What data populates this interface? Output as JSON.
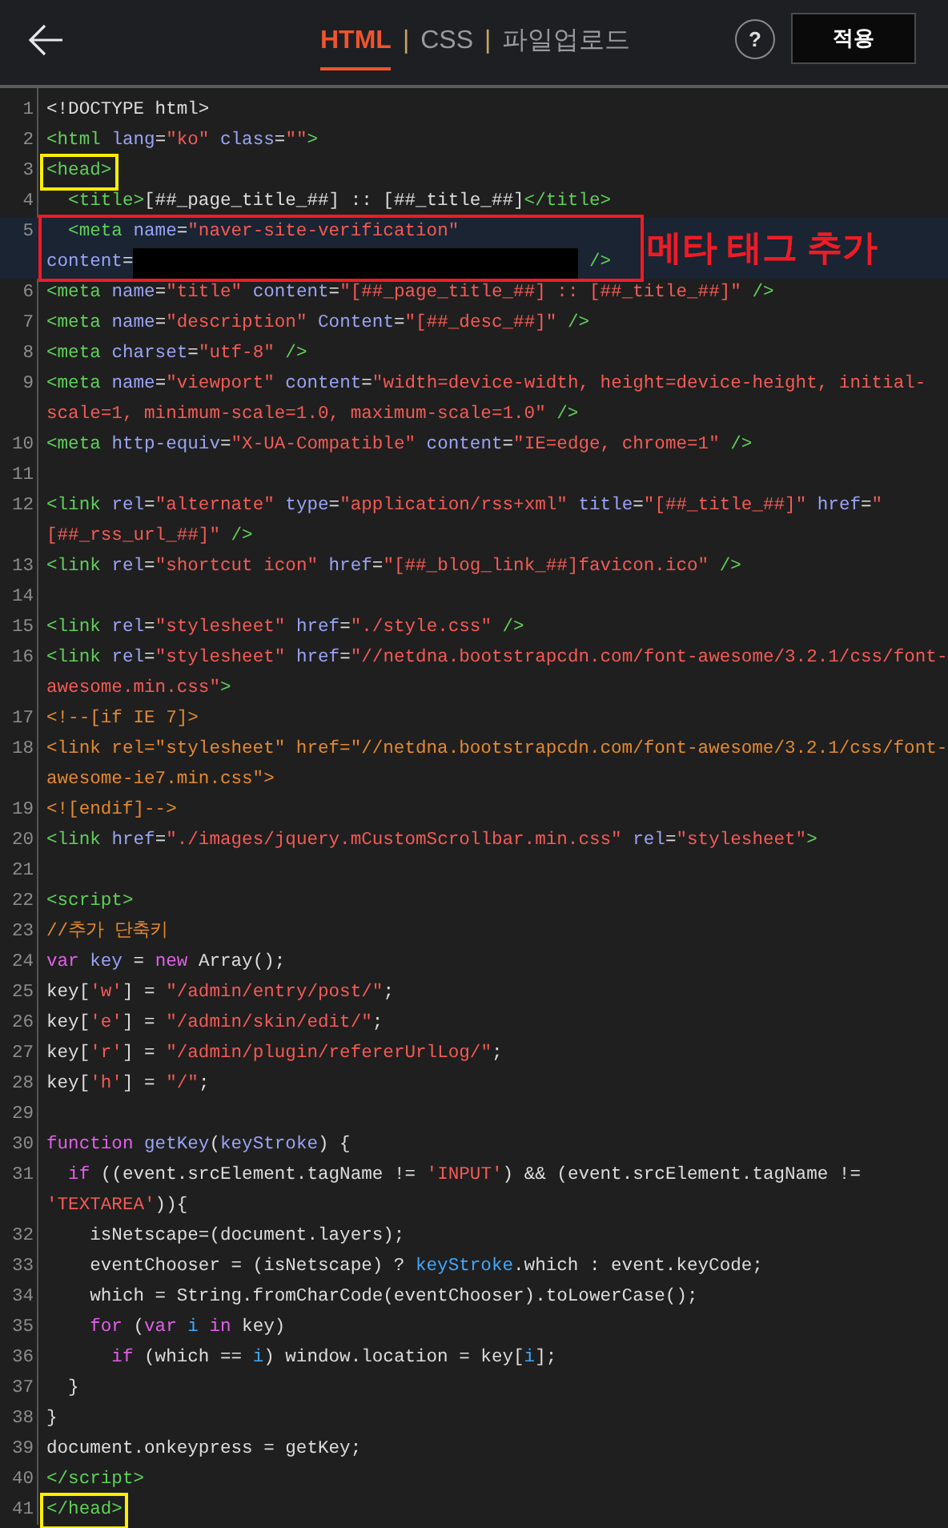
{
  "header": {
    "tabs": [
      {
        "label": "HTML",
        "selected": true
      },
      {
        "label": "CSS",
        "selected": false
      },
      {
        "label": "파일업로드",
        "selected": false
      }
    ],
    "separator": "|",
    "help": "?",
    "apply_button": "적용"
  },
  "editor": {
    "lines": [
      {
        "number": "1",
        "tokens": [
          {
            "kind": "plain",
            "text": "<!DOCTYPE html>"
          }
        ]
      },
      {
        "number": "2",
        "tokens": [
          {
            "kind": "tag",
            "text": "<html "
          },
          {
            "kind": "attr",
            "text": "lang"
          },
          {
            "kind": "plain",
            "text": "="
          },
          {
            "kind": "string",
            "text": "\"ko\" "
          },
          {
            "kind": "attr",
            "text": "class"
          },
          {
            "kind": "plain",
            "text": "="
          },
          {
            "kind": "string",
            "text": "\"\""
          },
          {
            "kind": "tag",
            "text": ">"
          }
        ]
      },
      {
        "number": "3",
        "marker": {
          "kind": "box",
          "color": "#ffee00"
        },
        "tokens": [
          {
            "kind": "tag",
            "text": "<head>"
          }
        ]
      },
      {
        "number": "4",
        "tokens": [
          {
            "kind": "tag",
            "text": "  <title>"
          },
          {
            "kind": "plain",
            "text": "[##_page_title_##] :: [##_title_##]"
          },
          {
            "kind": "tag",
            "text": "</title>"
          }
        ]
      },
      {
        "number": "5",
        "highlighted": true,
        "marker": {
          "kind": "box",
          "color": "#ee1c25",
          "note": "메타 태그 추가"
        },
        "tokens": [
          {
            "kind": "tag",
            "text": "  <meta "
          },
          {
            "kind": "attr",
            "text": "name"
          },
          {
            "kind": "plain",
            "text": "="
          },
          {
            "kind": "string",
            "text": "\"naver-site-verification\""
          },
          {
            "kind": "break"
          },
          {
            "kind": "attr",
            "text": "content"
          },
          {
            "kind": "plain",
            "text": "="
          },
          {
            "kind": "redaction"
          },
          {
            "kind": "tag",
            "text": " />"
          }
        ]
      },
      {
        "number": "6",
        "tokens": [
          {
            "kind": "tag",
            "text": "<meta "
          },
          {
            "kind": "attr",
            "text": "name"
          },
          {
            "kind": "plain",
            "text": "="
          },
          {
            "kind": "string",
            "text": "\"title\" "
          },
          {
            "kind": "attr",
            "text": "content"
          },
          {
            "kind": "plain",
            "text": "="
          },
          {
            "kind": "string",
            "text": "\"[##_page_title_##] :: [##_title_##]\""
          },
          {
            "kind": "tag",
            "text": " />"
          }
        ]
      },
      {
        "number": "7",
        "tokens": [
          {
            "kind": "tag",
            "text": "<meta "
          },
          {
            "kind": "attr",
            "text": "name"
          },
          {
            "kind": "plain",
            "text": "="
          },
          {
            "kind": "string",
            "text": "\"description\" "
          },
          {
            "kind": "attr",
            "text": "Content"
          },
          {
            "kind": "plain",
            "text": "="
          },
          {
            "kind": "string",
            "text": "\"[##_desc_##]\""
          },
          {
            "kind": "tag",
            "text": " />"
          }
        ]
      },
      {
        "number": "8",
        "tokens": [
          {
            "kind": "tag",
            "text": "<meta "
          },
          {
            "kind": "attr",
            "text": "charset"
          },
          {
            "kind": "plain",
            "text": "="
          },
          {
            "kind": "string",
            "text": "\"utf-8\""
          },
          {
            "kind": "tag",
            "text": " />"
          }
        ]
      },
      {
        "number": "9",
        "tokens": [
          {
            "kind": "tag",
            "text": "<meta "
          },
          {
            "kind": "attr",
            "text": "name"
          },
          {
            "kind": "plain",
            "text": "="
          },
          {
            "kind": "string",
            "text": "\"viewport\" "
          },
          {
            "kind": "attr",
            "text": "content"
          },
          {
            "kind": "plain",
            "text": "="
          },
          {
            "kind": "string",
            "text": "\"width=device-width, height=device-height, initial-"
          },
          {
            "kind": "break"
          },
          {
            "kind": "string",
            "text": "scale=1, minimum-scale=1.0, maximum-scale=1.0\""
          },
          {
            "kind": "tag",
            "text": " />"
          }
        ]
      },
      {
        "number": "10",
        "tokens": [
          {
            "kind": "tag",
            "text": "<meta "
          },
          {
            "kind": "attr",
            "text": "http-equiv"
          },
          {
            "kind": "plain",
            "text": "="
          },
          {
            "kind": "string",
            "text": "\"X-UA-Compatible\" "
          },
          {
            "kind": "attr",
            "text": "content"
          },
          {
            "kind": "plain",
            "text": "="
          },
          {
            "kind": "string",
            "text": "\"IE=edge, chrome=1\""
          },
          {
            "kind": "tag",
            "text": " />"
          }
        ]
      },
      {
        "number": "11"
      },
      {
        "number": "12",
        "tokens": [
          {
            "kind": "tag",
            "text": "<link "
          },
          {
            "kind": "attr",
            "text": "rel"
          },
          {
            "kind": "plain",
            "text": "="
          },
          {
            "kind": "string",
            "text": "\"alternate\" "
          },
          {
            "kind": "attr",
            "text": "type"
          },
          {
            "kind": "plain",
            "text": "="
          },
          {
            "kind": "string",
            "text": "\"application/rss+xml\" "
          },
          {
            "kind": "attr",
            "text": "title"
          },
          {
            "kind": "plain",
            "text": "="
          },
          {
            "kind": "string",
            "text": "\"[##_title_##]\" "
          },
          {
            "kind": "attr",
            "text": "href"
          },
          {
            "kind": "plain",
            "text": "="
          },
          {
            "kind": "string",
            "text": "\""
          },
          {
            "kind": "break"
          },
          {
            "kind": "string",
            "text": "[##_rss_url_##]\""
          },
          {
            "kind": "tag",
            "text": " />"
          }
        ]
      },
      {
        "number": "13",
        "tokens": [
          {
            "kind": "tag",
            "text": "<link "
          },
          {
            "kind": "attr",
            "text": "rel"
          },
          {
            "kind": "plain",
            "text": "="
          },
          {
            "kind": "string",
            "text": "\"shortcut icon\" "
          },
          {
            "kind": "attr",
            "text": "href"
          },
          {
            "kind": "plain",
            "text": "="
          },
          {
            "kind": "string",
            "text": "\"[##_blog_link_##]favicon.ico\""
          },
          {
            "kind": "tag",
            "text": " />"
          }
        ]
      },
      {
        "number": "14"
      },
      {
        "number": "15",
        "tokens": [
          {
            "kind": "tag",
            "text": "<link "
          },
          {
            "kind": "attr",
            "text": "rel"
          },
          {
            "kind": "plain",
            "text": "="
          },
          {
            "kind": "string",
            "text": "\"stylesheet\" "
          },
          {
            "kind": "attr",
            "text": "href"
          },
          {
            "kind": "plain",
            "text": "="
          },
          {
            "kind": "string",
            "text": "\"./style.css\""
          },
          {
            "kind": "tag",
            "text": " />"
          }
        ]
      },
      {
        "number": "16",
        "tokens": [
          {
            "kind": "tag",
            "text": "<link "
          },
          {
            "kind": "attr",
            "text": "rel"
          },
          {
            "kind": "plain",
            "text": "="
          },
          {
            "kind": "string",
            "text": "\"stylesheet\" "
          },
          {
            "kind": "attr",
            "text": "href"
          },
          {
            "kind": "plain",
            "text": "="
          },
          {
            "kind": "string",
            "text": "\"//netdna.bootstrapcdn.com/font-awesome/3.2.1/css/font-"
          },
          {
            "kind": "break"
          },
          {
            "kind": "string",
            "text": "awesome.min.css\""
          },
          {
            "kind": "tag",
            "text": ">"
          }
        ]
      },
      {
        "number": "17",
        "tokens": [
          {
            "kind": "comment",
            "text": "<!--[if IE 7]>"
          }
        ]
      },
      {
        "number": "18",
        "tokens": [
          {
            "kind": "comment",
            "text": "<link rel=\"stylesheet\" href=\"//netdna.bootstrapcdn.com/font-awesome/3.2.1/css/font-"
          },
          {
            "kind": "break"
          },
          {
            "kind": "comment",
            "text": "awesome-ie7.min.css\">"
          }
        ]
      },
      {
        "number": "19",
        "tokens": [
          {
            "kind": "comment",
            "text": "<![endif]-->"
          }
        ]
      },
      {
        "number": "20",
        "tokens": [
          {
            "kind": "tag",
            "text": "<link "
          },
          {
            "kind": "attr",
            "text": "href"
          },
          {
            "kind": "plain",
            "text": "="
          },
          {
            "kind": "string",
            "text": "\"./images/jquery.mCustomScrollbar.min.css\" "
          },
          {
            "kind": "attr",
            "text": "rel"
          },
          {
            "kind": "plain",
            "text": "="
          },
          {
            "kind": "string",
            "text": "\"stylesheet\""
          },
          {
            "kind": "tag",
            "text": ">"
          }
        ]
      },
      {
        "number": "21"
      },
      {
        "number": "22",
        "tokens": [
          {
            "kind": "tag",
            "text": "<script>"
          }
        ]
      },
      {
        "number": "23",
        "tokens": [
          {
            "kind": "comment",
            "text": "//추가 단축키"
          }
        ]
      },
      {
        "number": "24",
        "tokens": [
          {
            "kind": "keyword",
            "text": "var "
          },
          {
            "kind": "attr",
            "text": "key"
          },
          {
            "kind": "plain",
            "text": " = "
          },
          {
            "kind": "keyword",
            "text": "new "
          },
          {
            "kind": "plain",
            "text": "Array();"
          }
        ]
      },
      {
        "number": "25",
        "tokens": [
          {
            "kind": "plain",
            "text": "key["
          },
          {
            "kind": "string",
            "text": "'w'"
          },
          {
            "kind": "plain",
            "text": "] = "
          },
          {
            "kind": "string",
            "text": "\"/admin/entry/post/\""
          },
          {
            "kind": "plain",
            "text": ";"
          }
        ]
      },
      {
        "number": "26",
        "tokens": [
          {
            "kind": "plain",
            "text": "key["
          },
          {
            "kind": "string",
            "text": "'e'"
          },
          {
            "kind": "plain",
            "text": "] = "
          },
          {
            "kind": "string",
            "text": "\"/admin/skin/edit/\""
          },
          {
            "kind": "plain",
            "text": ";"
          }
        ]
      },
      {
        "number": "27",
        "tokens": [
          {
            "kind": "plain",
            "text": "key["
          },
          {
            "kind": "string",
            "text": "'r'"
          },
          {
            "kind": "plain",
            "text": "] = "
          },
          {
            "kind": "string",
            "text": "\"/admin/plugin/refererUrlLog/\""
          },
          {
            "kind": "plain",
            "text": ";"
          }
        ]
      },
      {
        "number": "28",
        "tokens": [
          {
            "kind": "plain",
            "text": "key["
          },
          {
            "kind": "string",
            "text": "'h'"
          },
          {
            "kind": "plain",
            "text": "] = "
          },
          {
            "kind": "string",
            "text": "\"/\""
          },
          {
            "kind": "plain",
            "text": ";"
          }
        ]
      },
      {
        "number": "29"
      },
      {
        "number": "30",
        "tokens": [
          {
            "kind": "keyword",
            "text": "function "
          },
          {
            "kind": "attr",
            "text": "getKey"
          },
          {
            "kind": "plain",
            "text": "("
          },
          {
            "kind": "attr",
            "text": "keyStroke"
          },
          {
            "kind": "plain",
            "text": ") {"
          }
        ]
      },
      {
        "number": "31",
        "tokens": [
          {
            "kind": "keyword",
            "text": "  if"
          },
          {
            "kind": "plain",
            "text": " ((event.srcElement.tagName != "
          },
          {
            "kind": "string",
            "text": "'INPUT'"
          },
          {
            "kind": "plain",
            "text": ") && (event.srcElement.tagName !="
          },
          {
            "kind": "break"
          },
          {
            "kind": "string",
            "text": "'TEXTAREA'"
          },
          {
            "kind": "plain",
            "text": ")){"
          }
        ]
      },
      {
        "number": "32",
        "tokens": [
          {
            "kind": "plain",
            "text": "    isNetscape=(document.layers);"
          }
        ]
      },
      {
        "number": "33",
        "tokens": [
          {
            "kind": "plain",
            "text": "    eventChooser = (isNetscape) ? "
          },
          {
            "kind": "variable",
            "text": "keyStroke"
          },
          {
            "kind": "plain",
            "text": ".which : event.keyCode;"
          }
        ]
      },
      {
        "number": "34",
        "tokens": [
          {
            "kind": "plain",
            "text": "    which = String.fromCharCode(eventChooser).toLowerCase();"
          }
        ]
      },
      {
        "number": "35",
        "tokens": [
          {
            "kind": "keyword",
            "text": "    for"
          },
          {
            "kind": "plain",
            "text": " ("
          },
          {
            "kind": "keyword",
            "text": "var"
          },
          {
            "kind": "variable",
            "text": " i"
          },
          {
            "kind": "keyword",
            "text": " in"
          },
          {
            "kind": "plain",
            "text": " key)"
          }
        ]
      },
      {
        "number": "36",
        "tokens": [
          {
            "kind": "keyword",
            "text": "      if"
          },
          {
            "kind": "plain",
            "text": " (which == "
          },
          {
            "kind": "variable",
            "text": "i"
          },
          {
            "kind": "plain",
            "text": ") window.location = key["
          },
          {
            "kind": "variable",
            "text": "i"
          },
          {
            "kind": "plain",
            "text": "];"
          }
        ]
      },
      {
        "number": "37",
        "tokens": [
          {
            "kind": "plain",
            "text": "  }"
          }
        ]
      },
      {
        "number": "38",
        "tokens": [
          {
            "kind": "plain",
            "text": "}"
          }
        ]
      },
      {
        "number": "39",
        "tokens": [
          {
            "kind": "plain",
            "text": "document.onkeypress = getKey;"
          }
        ]
      },
      {
        "number": "40",
        "tokens": [
          {
            "kind": "tag",
            "text": "</script>"
          }
        ]
      },
      {
        "number": "41",
        "marker": {
          "kind": "box",
          "color": "#ffee00"
        },
        "tokens": [
          {
            "kind": "tag",
            "text": "</head>"
          }
        ]
      }
    ]
  }
}
